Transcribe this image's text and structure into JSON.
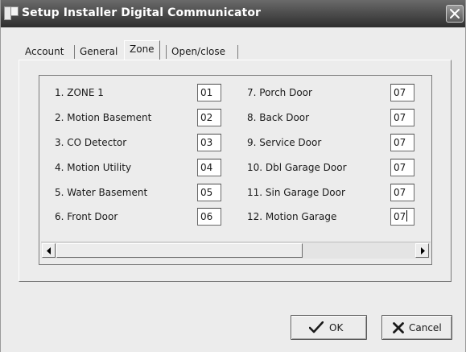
{
  "window": {
    "title": "Setup Installer Digital Communicator"
  },
  "tabs": [
    {
      "label": "Account",
      "active": false
    },
    {
      "label": "General",
      "active": false
    },
    {
      "label": "Zone",
      "active": true
    },
    {
      "label": "Open/close",
      "active": false
    }
  ],
  "zones": [
    {
      "label": "1. ZONE 1",
      "value": "01"
    },
    {
      "label": "2. Motion Basement",
      "value": "02"
    },
    {
      "label": "3. CO Detector",
      "value": "03"
    },
    {
      "label": "4. Motion Utility",
      "value": "04"
    },
    {
      "label": "5. Water Basement",
      "value": "05"
    },
    {
      "label": "6. Front Door",
      "value": "06"
    },
    {
      "label": "7. Porch Door",
      "value": "07"
    },
    {
      "label": "8. Back Door",
      "value": "07"
    },
    {
      "label": "9. Service Door",
      "value": "07"
    },
    {
      "label": "10. Dbl Garage Door",
      "value": "07"
    },
    {
      "label": "11. Sin Garage Door",
      "value": "07"
    },
    {
      "label": "12. Motion Garage",
      "value": "07"
    }
  ],
  "buttons": {
    "ok": "OK",
    "cancel": "Cancel"
  },
  "icons": {
    "ok": "checkmark-icon",
    "cancel": "x-icon",
    "close": "close-icon"
  }
}
